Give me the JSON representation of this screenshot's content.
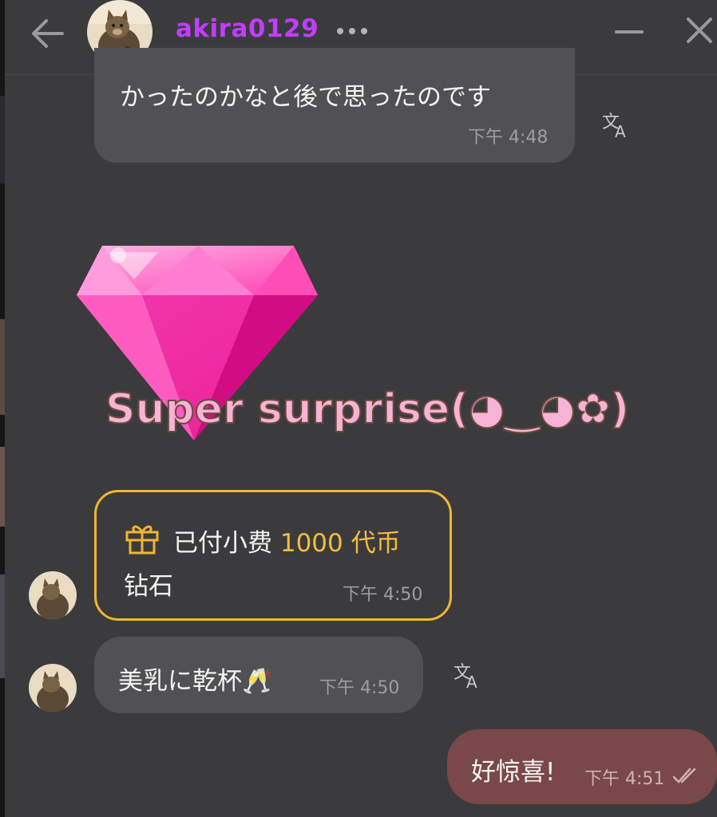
{
  "header": {
    "username": "akira0129"
  },
  "messages": [
    {
      "id": "m1",
      "text": "かったのかなと後で思ったのです",
      "time": "下午 4:48"
    },
    {
      "id": "m2",
      "sticker_text": "Super surprise(◕‿◕✿)"
    },
    {
      "id": "m3",
      "gift_label": "已付小费",
      "gift_amount": "1000 代币",
      "gift_item": "钻石",
      "time": "下午 4:50"
    },
    {
      "id": "m4",
      "text": "美乳に乾杯🥂",
      "time": "下午 4:50"
    },
    {
      "id": "m5",
      "text": "好惊喜!",
      "time": "下午 4:51"
    }
  ],
  "colors": {
    "background": "#3b3b3e",
    "incoming_bubble": "#515154",
    "outgoing_bubble": "#7a4848",
    "username": "#c23dff",
    "gift_accent": "#f2b531"
  },
  "icons": [
    "back-arrow-icon",
    "more-dots-icon",
    "minimize-icon",
    "close-icon",
    "translate-icon",
    "gift-icon",
    "double-check-icon"
  ]
}
